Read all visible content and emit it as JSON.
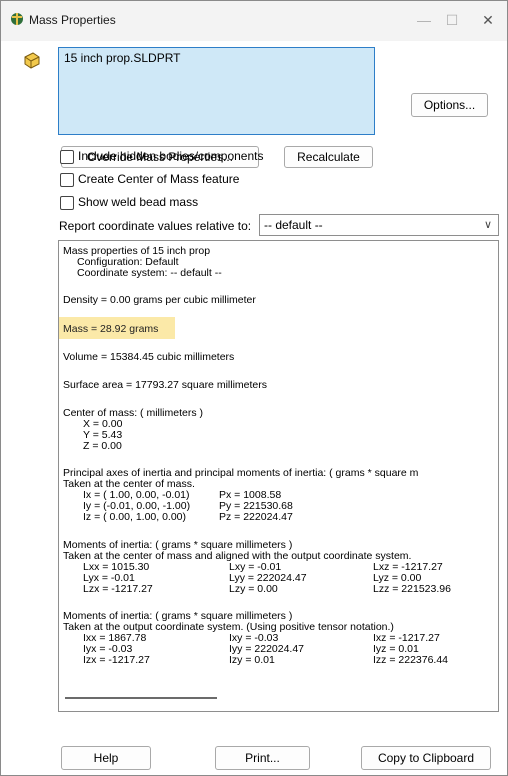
{
  "window": {
    "title": "Mass Properties",
    "minimize": "—",
    "maximize": "☐",
    "close": "✕"
  },
  "selection": {
    "item": "15 inch prop.SLDPRT"
  },
  "buttons": {
    "options": "Options...",
    "override": "Override Mass Properties...",
    "recalculate": "Recalculate",
    "help": "Help",
    "print": "Print...",
    "copy": "Copy to Clipboard"
  },
  "checkboxes": {
    "hidden": "Include hidden bodies/components",
    "center": "Create Center of Mass feature",
    "weld": "Show weld bead mass"
  },
  "report": {
    "label": "Report coordinate values relative to:",
    "value": "-- default --"
  },
  "results": {
    "header": "Mass properties of 15 inch prop",
    "config": "Configuration: Default",
    "coordsys": "Coordinate system: -- default --",
    "density": "Density = 0.00 grams per cubic millimeter",
    "mass": "Mass = 28.92 grams",
    "volume": "Volume = 15384.45 cubic millimeters",
    "surface": "Surface area = 17793.27  square millimeters",
    "com_title": "Center of mass: ( millimeters )",
    "com_x": "X = 0.00",
    "com_y": "Y = 5.43",
    "com_z": "Z = 0.00",
    "paxes_title": "Principal axes of inertia and principal moments of inertia: ( grams *  square m",
    "paxes_taken": "Taken at the center of mass.",
    "ix": "Ix = ( 1.00,  0.00, -0.01)",
    "iy": "Iy = (-0.01,  0.00, -1.00)",
    "iz": "Iz = ( 0.00,  1.00,  0.00)",
    "px": "Px = 1008.58",
    "py": "Py = 221530.68",
    "pz": "Pz = 222024.47",
    "moi1_title": "Moments of inertia: ( grams *  square millimeters )",
    "moi1_taken": "Taken at the center of mass and aligned with the output coordinate system.",
    "moi1": [
      [
        "Lxx = 1015.30",
        "Lxy = -0.01",
        "Lxz = -1217.27"
      ],
      [
        "Lyx = -0.01",
        "Lyy = 222024.47",
        "Lyz = 0.00"
      ],
      [
        "Lzx = -1217.27",
        "Lzy = 0.00",
        "Lzz = 221523.96"
      ]
    ],
    "moi2_title": "Moments of inertia: ( grams *  square millimeters )",
    "moi2_taken": "Taken at the output coordinate system. (Using positive tensor notation.)",
    "moi2": [
      [
        "Ixx = 1867.78",
        "Ixy = -0.03",
        "Ixz = -1217.27"
      ],
      [
        "Iyx = -0.03",
        "Iyy = 222024.47",
        "Iyz = 0.01"
      ],
      [
        "Izx = -1217.27",
        "Izy = 0.01",
        "Izz = 222376.44"
      ]
    ]
  },
  "colors": {
    "selection_bg": "#cfe8f7",
    "selection_border": "#2d7ec8",
    "highlight": "#fbe9a8"
  }
}
